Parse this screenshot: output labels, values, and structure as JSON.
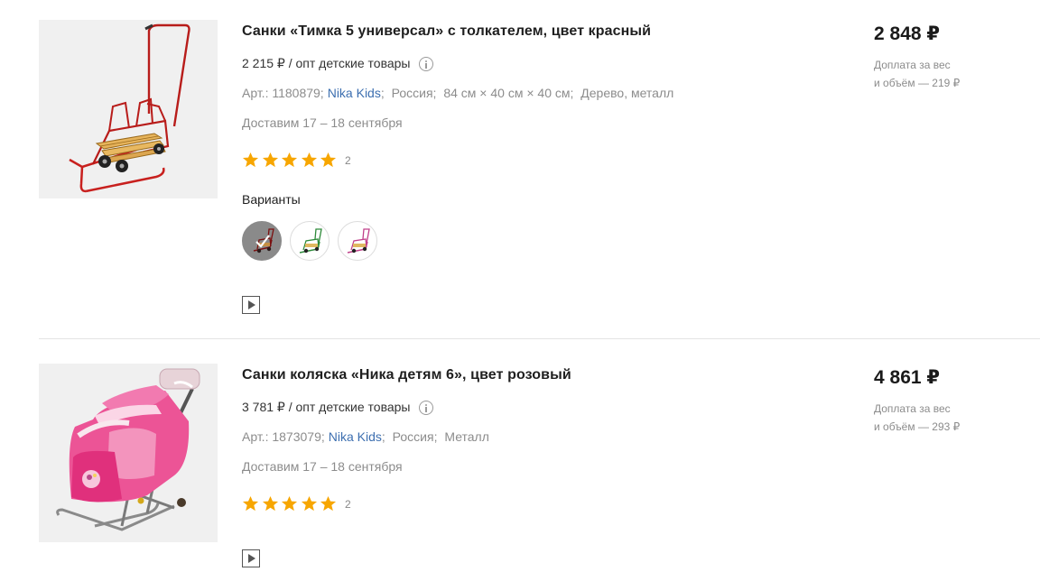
{
  "products": [
    {
      "title": "Санки «Тимка 5 универсал» с толкателем, цвет красный",
      "wholesale_text": "2 215 ₽ / опт детские товары",
      "article": "Арт.: 1180879;",
      "brand": "Nika Kids",
      "brand_sep": ";",
      "country": "Россия;",
      "dimensions": "84 см × 40 см × 40 см;",
      "material": "Дерево, металл",
      "delivery": "Доставим 17 – 18 сентября",
      "rating_stars": 5,
      "review_count": "2",
      "variants_label": "Варианты",
      "variants": [
        {
          "color": "red",
          "selected": true
        },
        {
          "color": "green",
          "selected": false
        },
        {
          "color": "pink",
          "selected": false
        }
      ],
      "price": "2 848 ₽",
      "surcharge_line1": "Доплата за вес",
      "surcharge_line2": "и объём — 219 ₽",
      "image_icon": "red-sled-with-pusher"
    },
    {
      "title": "Санки коляска «Ника детям 6», цвет розовый",
      "wholesale_text": "3 781 ₽ / опт детские товары",
      "article": "Арт.: 1873079;",
      "brand": "Nika Kids",
      "brand_sep": ";",
      "country": "Россия;",
      "material": "Металл",
      "delivery": "Доставим 17 – 18 сентября",
      "rating_stars": 5,
      "review_count": "2",
      "price": "4 861 ₽",
      "surcharge_line1": "Доплата за вес",
      "surcharge_line2": "и объём — 293 ₽",
      "image_icon": "pink-sled-stroller"
    }
  ],
  "colors": {
    "star": "#f7a600",
    "brand_link": "#3d6fb0",
    "muted_text": "#8c8c8c",
    "sled_red": "#c8201e",
    "stroller_pink": "#e8488a"
  }
}
